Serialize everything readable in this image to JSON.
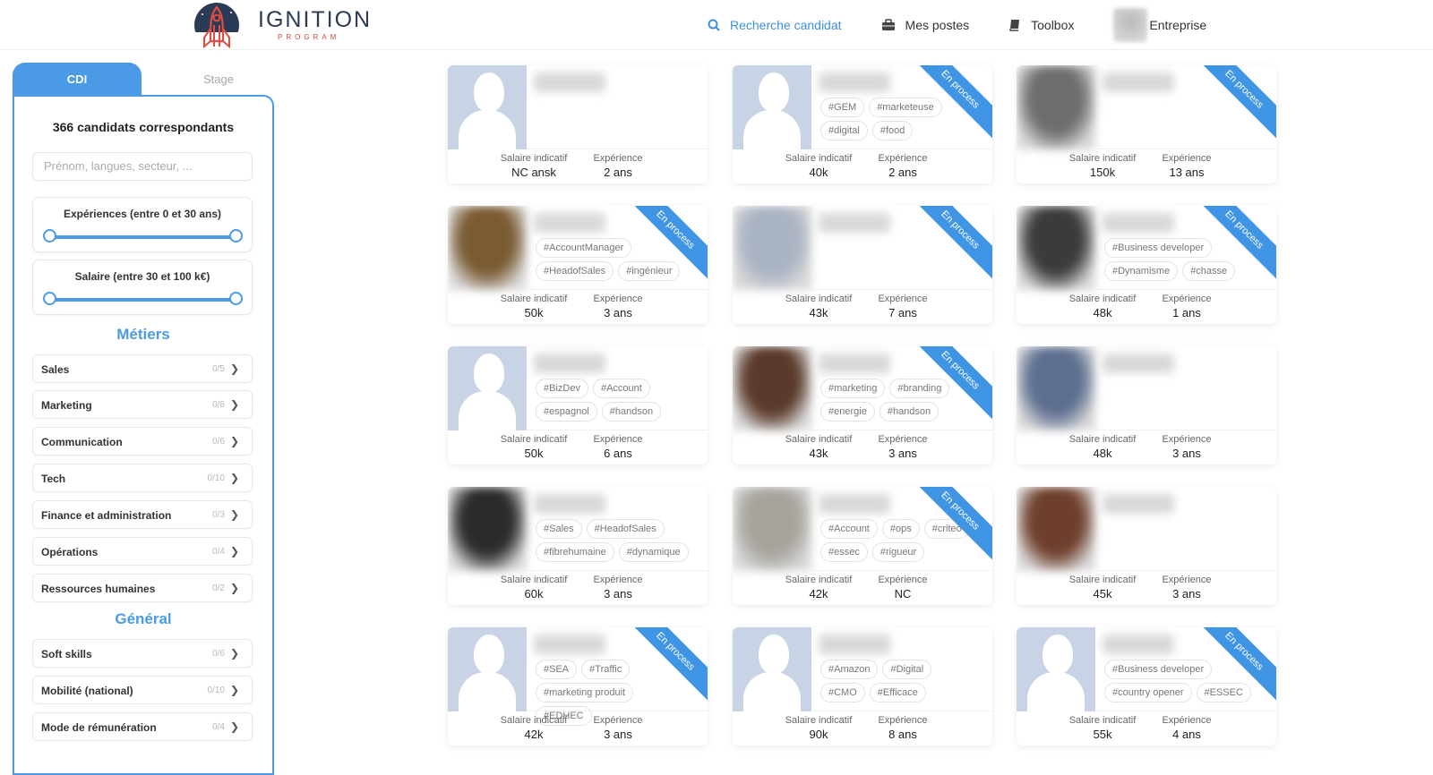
{
  "header": {
    "logo_title": "IGNITION",
    "logo_subtitle": "PROGRAM",
    "nav": [
      {
        "label": "Recherche candidat",
        "icon": "search-icon"
      },
      {
        "label": "Mes postes",
        "icon": "briefcase-icon"
      },
      {
        "label": "Toolbox",
        "icon": "book-icon"
      },
      {
        "label": "Entreprise",
        "icon": "company-avatar"
      }
    ]
  },
  "sidebar": {
    "tabs": [
      "CDI",
      "Stage"
    ],
    "count_text": "366 candidats correspondants",
    "search_placeholder": "Prénom, langues, secteur, ...",
    "experience_label": "Expériences (entre 0 et 30 ans)",
    "experience_range": [
      0,
      30
    ],
    "salary_label": "Salaire (entre 30 et 100 k€)",
    "salary_range": [
      30,
      100
    ],
    "metiers_title": "Métiers",
    "metiers": [
      {
        "label": "Sales",
        "count": "0/5"
      },
      {
        "label": "Marketing",
        "count": "0/8"
      },
      {
        "label": "Communication",
        "count": "0/6"
      },
      {
        "label": "Tech",
        "count": "0/10"
      },
      {
        "label": "Finance et administration",
        "count": "0/3"
      },
      {
        "label": "Opérations",
        "count": "0/4"
      },
      {
        "label": "Ressources humaines",
        "count": "0/2"
      }
    ],
    "general_title": "Général",
    "general": [
      {
        "label": "Soft skills",
        "count": "0/6"
      },
      {
        "label": "Mobilité (national)",
        "count": "0/10"
      },
      {
        "label": "Mode de rémunération",
        "count": "0/4"
      }
    ]
  },
  "card_labels": {
    "salary": "Salaire indicatif",
    "experience": "Expérience",
    "ribbon": "En process"
  },
  "candidates": [
    {
      "photo": "placeholder",
      "tags": [],
      "salary": "NC ansk",
      "experience": "2 ans",
      "process": false
    },
    {
      "photo": "placeholder",
      "tags": [
        "#GEM",
        "#marketeuse",
        "#digital",
        "#food"
      ],
      "salary": "40k",
      "experience": "2 ans",
      "process": true
    },
    {
      "photo": "#6d6d6d",
      "tags": [],
      "salary": "150k",
      "experience": "13 ans",
      "process": true
    },
    {
      "photo": "#7a5b33",
      "tags": [
        "#AccountManager",
        "#HeadofSales",
        "#ingénieur"
      ],
      "salary": "50k",
      "experience": "3 ans",
      "process": true
    },
    {
      "photo": "#a9b3c2",
      "tags": [],
      "salary": "43k",
      "experience": "7 ans",
      "process": true
    },
    {
      "photo": "#3b3b3b",
      "tags": [
        "#Business developer",
        "#Dynamisme",
        "#chasse"
      ],
      "salary": "48k",
      "experience": "1 ans",
      "process": true
    },
    {
      "photo": "placeholder",
      "tags": [
        "#BizDev",
        "#Account",
        "#espagnol",
        "#handson"
      ],
      "salary": "50k",
      "experience": "6 ans",
      "process": false
    },
    {
      "photo": "#5a3a2a",
      "tags": [
        "#marketing",
        "#branding",
        "#energie",
        "#handson"
      ],
      "salary": "43k",
      "experience": "3 ans",
      "process": true
    },
    {
      "photo": "#5d6f8f",
      "tags": [],
      "salary": "48k",
      "experience": "3 ans",
      "process": false
    },
    {
      "photo": "#2b2b2b",
      "tags": [
        "#Sales",
        "#HeadofSales",
        "#fibrehumaine",
        "#dynamique"
      ],
      "salary": "60k",
      "experience": "3 ans",
      "process": false
    },
    {
      "photo": "#a7a49c",
      "tags": [
        "#Account",
        "#ops",
        "#criteo",
        "#essec",
        "#rigueur"
      ],
      "salary": "42k",
      "experience": "NC",
      "process": true
    },
    {
      "photo": "#6e3f2c",
      "tags": [],
      "salary": "45k",
      "experience": "3 ans",
      "process": false
    },
    {
      "photo": "placeholder",
      "tags": [
        "#SEA",
        "#Traffic",
        "#marketing produit",
        "#EDHEC"
      ],
      "salary": "42k",
      "experience": "3 ans",
      "process": true
    },
    {
      "photo": "placeholder",
      "tags": [
        "#Amazon",
        "#Digital",
        "#CMO",
        "#Efficace"
      ],
      "salary": "90k",
      "experience": "8 ans",
      "process": false
    },
    {
      "photo": "placeholder",
      "tags": [
        "#Business developer",
        "#country opener",
        "#ESSEC"
      ],
      "salary": "55k",
      "experience": "4 ans",
      "process": true
    }
  ]
}
